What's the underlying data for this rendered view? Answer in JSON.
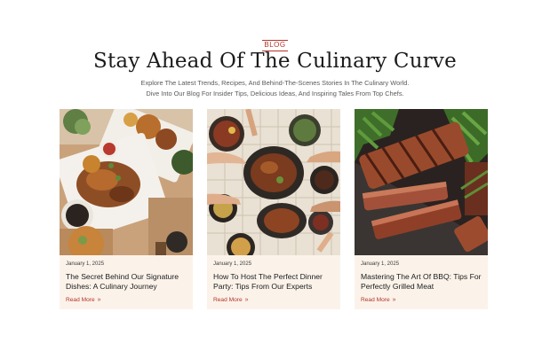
{
  "section": {
    "eyebrow": "BLOG",
    "headline": "Stay Ahead Of The Culinary Curve",
    "sub_line_1": "Explore The Latest Trends, Recipes, And Behind-The-Scenes Stories In The Culinary World.",
    "sub_line_2": "Dive Into Our Blog For Insider Tips, Delicious Ideas, And Inspiring Tales From Top Chefs."
  },
  "posts": [
    {
      "date": "January 1, 2025",
      "title": "The Secret Behind Our Signature Dishes: A Culinary Journey",
      "read_more": "Read More",
      "image_name": "signature-dishes-photo"
    },
    {
      "date": "January 1, 2025",
      "title": "How To Host The Perfect Dinner Party: Tips From Our Experts",
      "read_more": "Read More",
      "image_name": "dinner-party-photo"
    },
    {
      "date": "January 1, 2025",
      "title": "Mastering The Art Of BBQ: Tips For Perfectly Grilled Meat",
      "read_more": "Read More",
      "image_name": "bbq-meat-photo"
    }
  ],
  "colors": {
    "accent": "#b3342a",
    "card_background": "#fbf3ea",
    "heading": "#1b1b1b",
    "body_text": "#5a5a5a"
  },
  "icons": {
    "read_more": "double-chevron-right-icon"
  }
}
